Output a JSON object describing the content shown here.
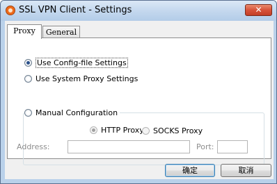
{
  "window": {
    "title": "SSL VPN Client - Settings",
    "close_glyph": "✕"
  },
  "tabs": [
    {
      "label": "Proxy",
      "selected": true
    },
    {
      "label": "General",
      "selected": false
    }
  ],
  "proxy": {
    "options": [
      {
        "label": "Use Config-file Settings",
        "selected": true
      },
      {
        "label": "Use System Proxy Settings",
        "selected": false
      },
      {
        "label": "Manual Configuration",
        "selected": false
      }
    ],
    "manual": {
      "http_label": "HTTP Proxy",
      "socks_label": "SOCKS Proxy",
      "http_selected": true,
      "address_label": "Address:",
      "address_value": "",
      "port_label": "Port:",
      "port_value": ""
    }
  },
  "buttons": {
    "ok": "确定",
    "cancel": "取消"
  }
}
